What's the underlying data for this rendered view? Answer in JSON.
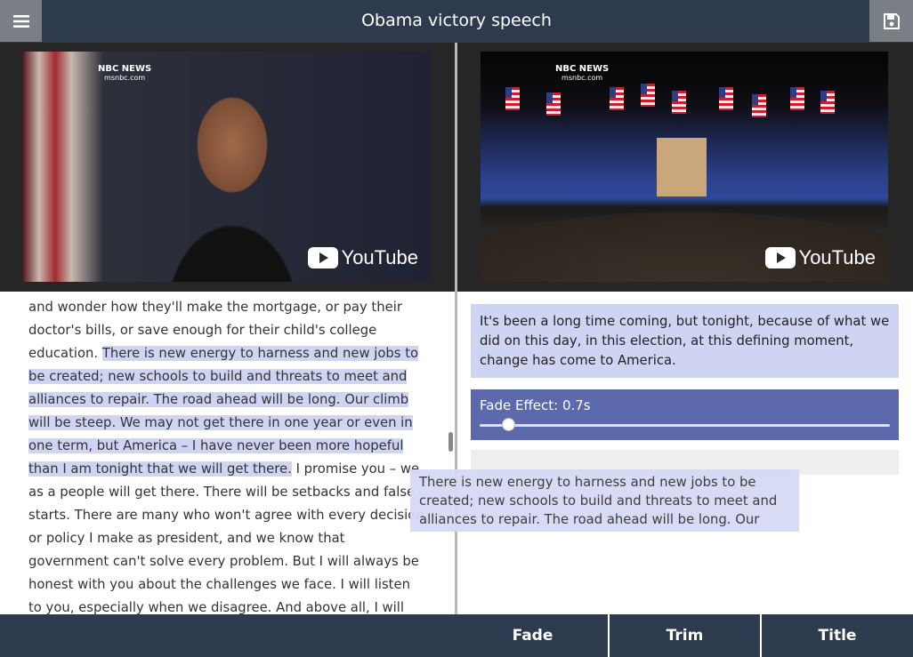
{
  "app": {
    "title": "Obama victory speech"
  },
  "videos": {
    "left": {
      "network": "NBC NEWS",
      "network_sub": "msnbc.com",
      "player": "YouTube"
    },
    "right": {
      "network": "NBC NEWS",
      "network_sub": "msnbc.com",
      "player": "YouTube"
    }
  },
  "transcript": {
    "before": "and wonder how they'll make the mortgage, or pay their doctor's bills, or save enough for their child's college education. ",
    "highlighted": "There is new energy to harness and new jobs to be created; new schools to build and threats to meet and alliances to repair. The road ahead will be long. Our climb will be steep. We may not get there in one year or even in one term, but America – I have never been more hopeful than I am tonight that we will get there.",
    "after": " I promise you – we as a people will get there. There will be setbacks and false starts. There are many who won't agree with every decision or policy I make as president, and we know that government can't solve every problem. But I will always be honest with you about the challenges we face. I will listen to you, especially when we disagree. And above all, I will ask"
  },
  "timeline": {
    "clip_text": "It's been a long time coming, but tonight, because of what we did on this day, in this election, at this defining moment, change has come to America.",
    "fade_label": "Fade Effect: 0.7s",
    "fade_value_fraction": 0.07
  },
  "drag_preview": {
    "text": "There is new energy to harness and new jobs to be created; new schools to build and threats to meet and alliances to repair. The road ahead will be long. Our climb will be steep."
  },
  "toolbar": {
    "fade": "Fade",
    "trim": "Trim",
    "title": "Title"
  },
  "colors": {
    "bar": "#2e3b4e",
    "highlight": "#cfd4f2",
    "fade_card": "#5c6aad"
  },
  "icons": {
    "menu": "hamburger-icon",
    "save": "floppy-disk-icon"
  }
}
